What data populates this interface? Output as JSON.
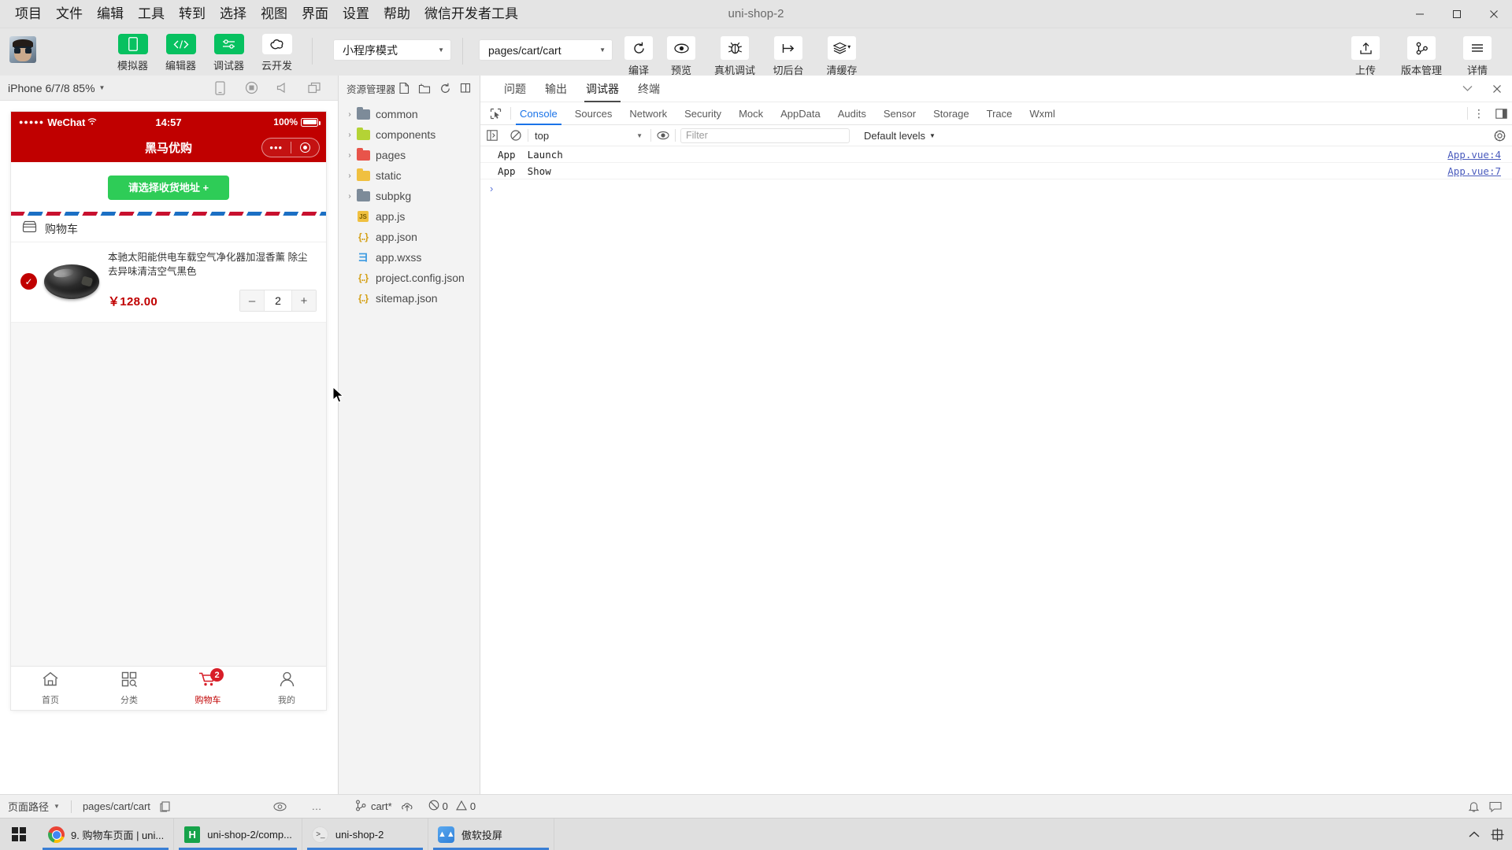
{
  "window": {
    "title": "uni-shop-2",
    "minimize": "–",
    "maximize": "❐",
    "close": "✕"
  },
  "menubar": {
    "items": [
      "项目",
      "文件",
      "编辑",
      "工具",
      "转到",
      "选择",
      "视图",
      "界面",
      "设置",
      "帮助",
      "微信开发者工具"
    ]
  },
  "toolbar": {
    "mode_buttons": [
      {
        "label": "模拟器",
        "icon": "phone-icon",
        "style": "green"
      },
      {
        "label": "编辑器",
        "icon": "code-icon",
        "style": "green"
      },
      {
        "label": "调试器",
        "icon": "debugger-icon",
        "style": "green"
      },
      {
        "label": "云开发",
        "icon": "cloud-icon",
        "style": "white"
      }
    ],
    "compile_mode": {
      "value": "小程序模式",
      "caret": "▼"
    },
    "page_route": {
      "value": "pages/cart/cart",
      "caret": "▼"
    },
    "actions": [
      {
        "label": "编译",
        "icon": "refresh-icon"
      },
      {
        "label": "预览",
        "icon": "eye-icon"
      },
      {
        "label": "真机调试",
        "icon": "bug-icon"
      },
      {
        "label": "切后台",
        "icon": "background-icon"
      },
      {
        "label": "清缓存",
        "icon": "layers-icon"
      }
    ],
    "right_actions": [
      {
        "label": "上传",
        "icon": "upload-icon"
      },
      {
        "label": "版本管理",
        "icon": "branch-icon"
      },
      {
        "label": "详情",
        "icon": "hamburger-icon"
      }
    ]
  },
  "simulator": {
    "device": "iPhone 6/7/8 85%",
    "caret": "▼",
    "icons": [
      "device-icon",
      "record-icon",
      "volume-icon",
      "windows-icon"
    ],
    "phone": {
      "status": {
        "signal_dots": "●●●●●",
        "carrier": "WeChat",
        "wifi": "≈",
        "time": "14:57",
        "battery_pct": "100%"
      },
      "nav_title": "黑马优购",
      "capsule": {
        "more": "•••",
        "target": "target-icon"
      },
      "address_button": "请选择收货地址 +",
      "section_title": "购物车",
      "section_icon": "store-icon",
      "cart_items": [
        {
          "checked": true,
          "check_icon": "✓",
          "name": "本驰太阳能供电车载空气净化器加湿香薰 除尘去异味清洁空气黑色",
          "price": "￥128.00",
          "minus": "–",
          "quantity": "2",
          "plus": "+"
        }
      ],
      "tabbar": [
        {
          "label": "首页",
          "icon": "home-icon",
          "active": false,
          "badge": ""
        },
        {
          "label": "分类",
          "icon": "category-icon",
          "active": false,
          "badge": ""
        },
        {
          "label": "购物车",
          "icon": "cart-icon",
          "active": true,
          "badge": "2"
        },
        {
          "label": "我的",
          "icon": "user-icon",
          "active": false,
          "badge": ""
        }
      ]
    }
  },
  "explorer": {
    "title": "资源管理器: MP-...",
    "actions": [
      "new-file-icon",
      "new-folder-icon",
      "refresh-icon",
      "collapse-icon"
    ],
    "tree": [
      {
        "name": "common",
        "type": "folder",
        "arrow": "›",
        "color": "#7d8b99"
      },
      {
        "name": "components",
        "type": "folder",
        "arrow": "›",
        "color": "#b4d335"
      },
      {
        "name": "pages",
        "type": "folder",
        "arrow": "›",
        "color": "#e8544a"
      },
      {
        "name": "static",
        "type": "folder",
        "arrow": "›",
        "color": "#f0c040"
      },
      {
        "name": "subpkg",
        "type": "folder",
        "arrow": "›",
        "color": "#7d8b99"
      },
      {
        "name": "app.js",
        "type": "js",
        "arrow": "",
        "color": "#f0c040"
      },
      {
        "name": "app.json",
        "type": "json",
        "arrow": "",
        "color": "#d4a017"
      },
      {
        "name": "app.wxss",
        "type": "wxss",
        "arrow": "",
        "color": "#3b9ae1"
      },
      {
        "name": "project.config.json",
        "type": "json",
        "arrow": "",
        "color": "#d4a017"
      },
      {
        "name": "sitemap.json",
        "type": "json",
        "arrow": "",
        "color": "#d4a017"
      }
    ]
  },
  "devtools": {
    "panel_tabs": [
      {
        "label": "问题",
        "active": false
      },
      {
        "label": "输出",
        "active": false
      },
      {
        "label": "调试器",
        "active": true
      },
      {
        "label": "终端",
        "active": false
      }
    ],
    "panel_controls": [
      "chevron-down-icon",
      "close-icon"
    ],
    "devtools_tabs": [
      {
        "label": "Console",
        "active": true
      },
      {
        "label": "Sources",
        "active": false
      },
      {
        "label": "Network",
        "active": false
      },
      {
        "label": "Security",
        "active": false
      },
      {
        "label": "Mock",
        "active": false
      },
      {
        "label": "AppData",
        "active": false
      },
      {
        "label": "Audits",
        "active": false
      },
      {
        "label": "Sensor",
        "active": false
      },
      {
        "label": "Storage",
        "active": false
      },
      {
        "label": "Trace",
        "active": false
      },
      {
        "label": "Wxml",
        "active": false
      }
    ],
    "devtools_right": [
      "more-vertical-icon",
      "dock-icon"
    ],
    "console_bar": {
      "context": "top",
      "caret": "▼",
      "filter_placeholder": "Filter",
      "levels": "Default levels",
      "levels_caret": "▼",
      "gear": "gear-icon"
    },
    "console_logs": [
      {
        "message": "App  Launch",
        "source": "App.vue:4"
      },
      {
        "message": "App  Show",
        "source": "App.vue:7"
      }
    ],
    "prompt": "›"
  },
  "statusbar": {
    "page_path_label": "页面路径",
    "caret": "▼",
    "divider": "|",
    "path": "pages/cart/cart",
    "copy_icon": "copy-icon",
    "eye_icon": "eye-icon",
    "more_icon": "…",
    "git_branch": "cart*",
    "git_icon": "branch-icon",
    "sync_icon": "cloud-sync-icon",
    "errors": "0",
    "warnings": "0",
    "error_icon": "⊗",
    "warning_icon": "⚠",
    "bell_icon": "bell-icon",
    "feedback_icon": "feedback-icon"
  },
  "taskbar": {
    "start_icon": "windows-icon",
    "items": [
      {
        "label": "9. 购物车页面 | uni...",
        "icon": "chrome-icon"
      },
      {
        "label": "uni-shop-2/comp...",
        "icon": "hbuilder-icon"
      },
      {
        "label": "uni-shop-2",
        "icon": "wechat-devtools-icon"
      },
      {
        "label": "傲软投屏",
        "icon": "apowermirror-icon"
      }
    ],
    "tray": [
      "show-hidden-icon",
      "ime-icon"
    ]
  },
  "colors": {
    "brand_green": "#07c160",
    "wechat_red": "#c00000",
    "accent_blue": "#1a73e8",
    "taskbar_active": "#3a7fd5"
  }
}
